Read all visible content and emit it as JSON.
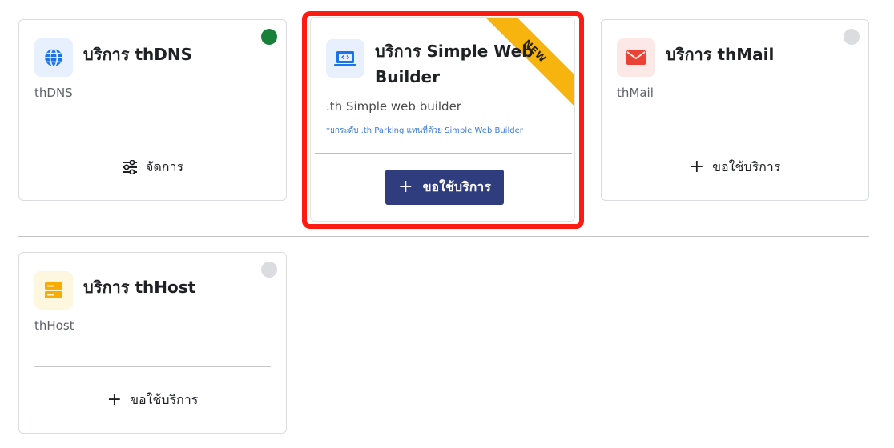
{
  "cards": {
    "dns": {
      "title": "บริการ thDNS",
      "subtitle": "thDNS",
      "action_label": "จัดการ",
      "status": "active",
      "icon": "globe-icon",
      "icon_color": "#1a73e8",
      "icon_bg": "#e8f0fe"
    },
    "web": {
      "title": "บริการ Simple Web Builder",
      "subtitle": ".th Simple web builder",
      "note": "*ยกระดับ .th Parking แทนที่ด้วย Simple Web Builder",
      "badge": "NEW",
      "action_label": "ขอใช้บริการ",
      "icon": "laptop-code-icon",
      "icon_color": "#1a73e8",
      "icon_bg": "#e8f0fe"
    },
    "mail": {
      "title": "บริการ thMail",
      "subtitle": "thMail",
      "action_label": "ขอใช้บริการ",
      "status": "inactive",
      "icon": "mail-icon",
      "icon_color": "#ea4335",
      "icon_bg": "#fce8e6"
    },
    "host": {
      "title": "บริการ thHost",
      "subtitle": "thHost",
      "action_label": "ขอใช้บริการ",
      "status": "inactive",
      "icon": "server-icon",
      "icon_color": "#f9ab00",
      "icon_bg": "#fef7e0"
    }
  },
  "colors": {
    "primary_button": "#2f3d7e",
    "highlight_border": "#ff1a12",
    "ribbon": "#f7b40f",
    "status_active": "#188038",
    "status_inactive": "#dadce0"
  }
}
